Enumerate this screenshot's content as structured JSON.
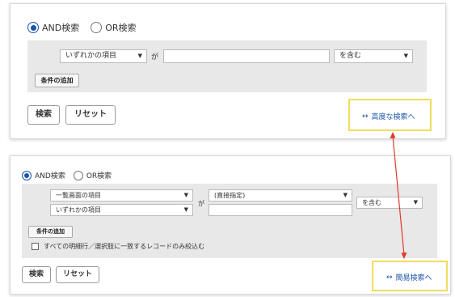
{
  "advanced_form": {
    "match_and": "AND検索",
    "match_or": "OR検索",
    "field_select": "いずれかの項目",
    "particle": "が",
    "operator_select": "を含む",
    "add_condition": "条件の追加",
    "search": "検索",
    "reset": "リセット",
    "switch_link": "高度な検索へ"
  },
  "detail_form": {
    "match_and": "AND検索",
    "match_or": "OR検索",
    "screen_field_select": "一覧画面の項目",
    "field_select": "いずれかの項目",
    "particle": "が",
    "value_select": "(直接指定)",
    "operator_select": "を含む",
    "add_condition": "条件の追加",
    "restrict_label": "すべての明細行／選択肢に一致するレコードのみ絞込む",
    "search": "検索",
    "reset": "リセット",
    "switch_link": "簡易検索へ"
  },
  "colors": {
    "highlight": "#f2dc5c",
    "arrow": "#e2392b",
    "accent": "#1a55a8"
  }
}
